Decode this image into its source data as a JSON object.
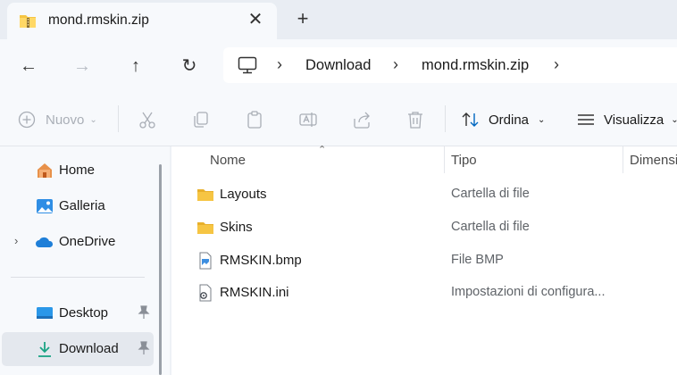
{
  "tab": {
    "title": "mond.rmskin.zip",
    "close_symbol": "✕",
    "new_tab_symbol": "+"
  },
  "nav": {
    "back": "←",
    "forward": "→",
    "up": "↑",
    "refresh": "↻"
  },
  "address": {
    "separator": "›",
    "crumbs": [
      "Download",
      "mond.rmskin.zip"
    ]
  },
  "toolbar": {
    "new_label": "Nuovo",
    "sort_label": "Ordina",
    "view_label": "Visualizza"
  },
  "sidebar": {
    "items": [
      {
        "label": "Home"
      },
      {
        "label": "Galleria"
      },
      {
        "label": "OneDrive",
        "expand": "›"
      },
      {
        "label": "Desktop"
      },
      {
        "label": "Download"
      }
    ]
  },
  "columns": {
    "name": "Nome",
    "type": "Tipo",
    "size": "Dimensi"
  },
  "files": [
    {
      "name": "Layouts",
      "type": "Cartella di file",
      "icon": "folder-icon"
    },
    {
      "name": "Skins",
      "type": "Cartella di file",
      "icon": "folder-icon"
    },
    {
      "name": "RMSKIN.bmp",
      "type": "File BMP",
      "icon": "image-file-icon"
    },
    {
      "name": "RMSKIN.ini",
      "type": "Impostazioni di configura...",
      "icon": "settings-file-icon"
    }
  ],
  "colors": {
    "accent": "#0067c0",
    "folder": "#f6c543",
    "selected_bg": "#e4e8ee"
  }
}
